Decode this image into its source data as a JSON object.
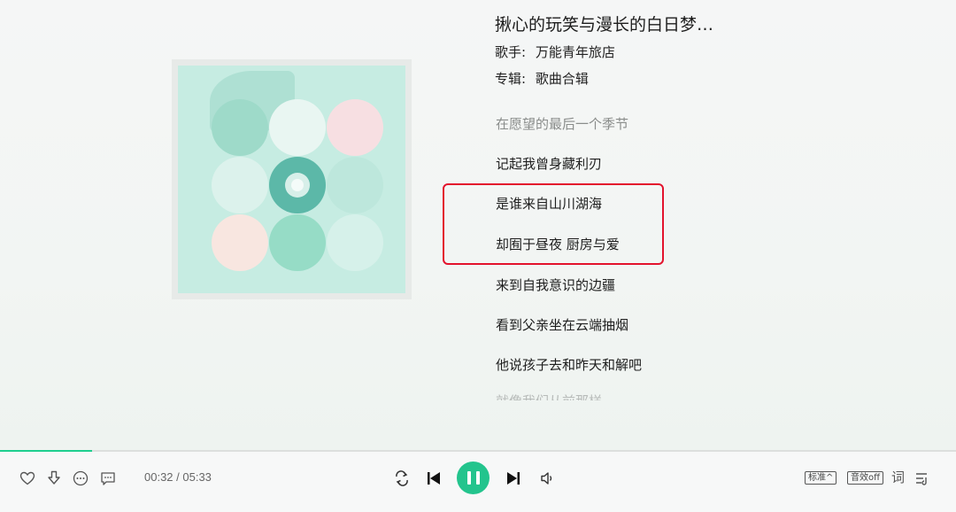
{
  "song": {
    "title": "揪心的玩笑与漫长的白日梦…",
    "artist_label": "歌手:",
    "artist": "万能青年旅店",
    "album_label": "专辑:",
    "album": "歌曲合辑"
  },
  "lyrics": {
    "prev_line": "在愿望的最后一个季节",
    "lines": [
      "记起我曾身藏利刃",
      "是谁来自山川湖海",
      "却囿于昼夜 厨房与爱",
      "来到自我意识的边疆",
      "看到父亲坐在云端抽烟",
      "他说孩子去和昨天和解吧"
    ],
    "next_line": "就像我们从前那样"
  },
  "player": {
    "time": "00:32 / 05:33",
    "progress": 0.096,
    "quality_label": "标准^",
    "effect_label": "音效off",
    "lyric_toggle": "词",
    "accent": "#23c48d"
  },
  "icons": [
    "heart-icon",
    "download-icon",
    "more-icon",
    "comment-icon",
    "loop-icon",
    "previous-icon",
    "pause-icon",
    "next-icon",
    "volume-icon",
    "playlist-icon"
  ]
}
